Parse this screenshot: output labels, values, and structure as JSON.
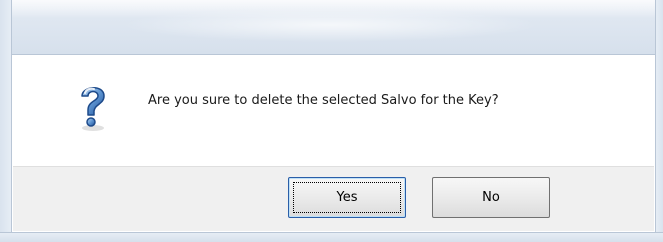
{
  "dialog": {
    "message": "Are you sure to delete the selected Salvo for the Key?",
    "icon": "question-icon",
    "buttons": {
      "yes_label": "Yes",
      "no_label": "No"
    }
  },
  "colors": {
    "frame": "#dfe7f1",
    "button_strip": "#f0f0f0",
    "default_button_border": "#2a5ea8"
  }
}
